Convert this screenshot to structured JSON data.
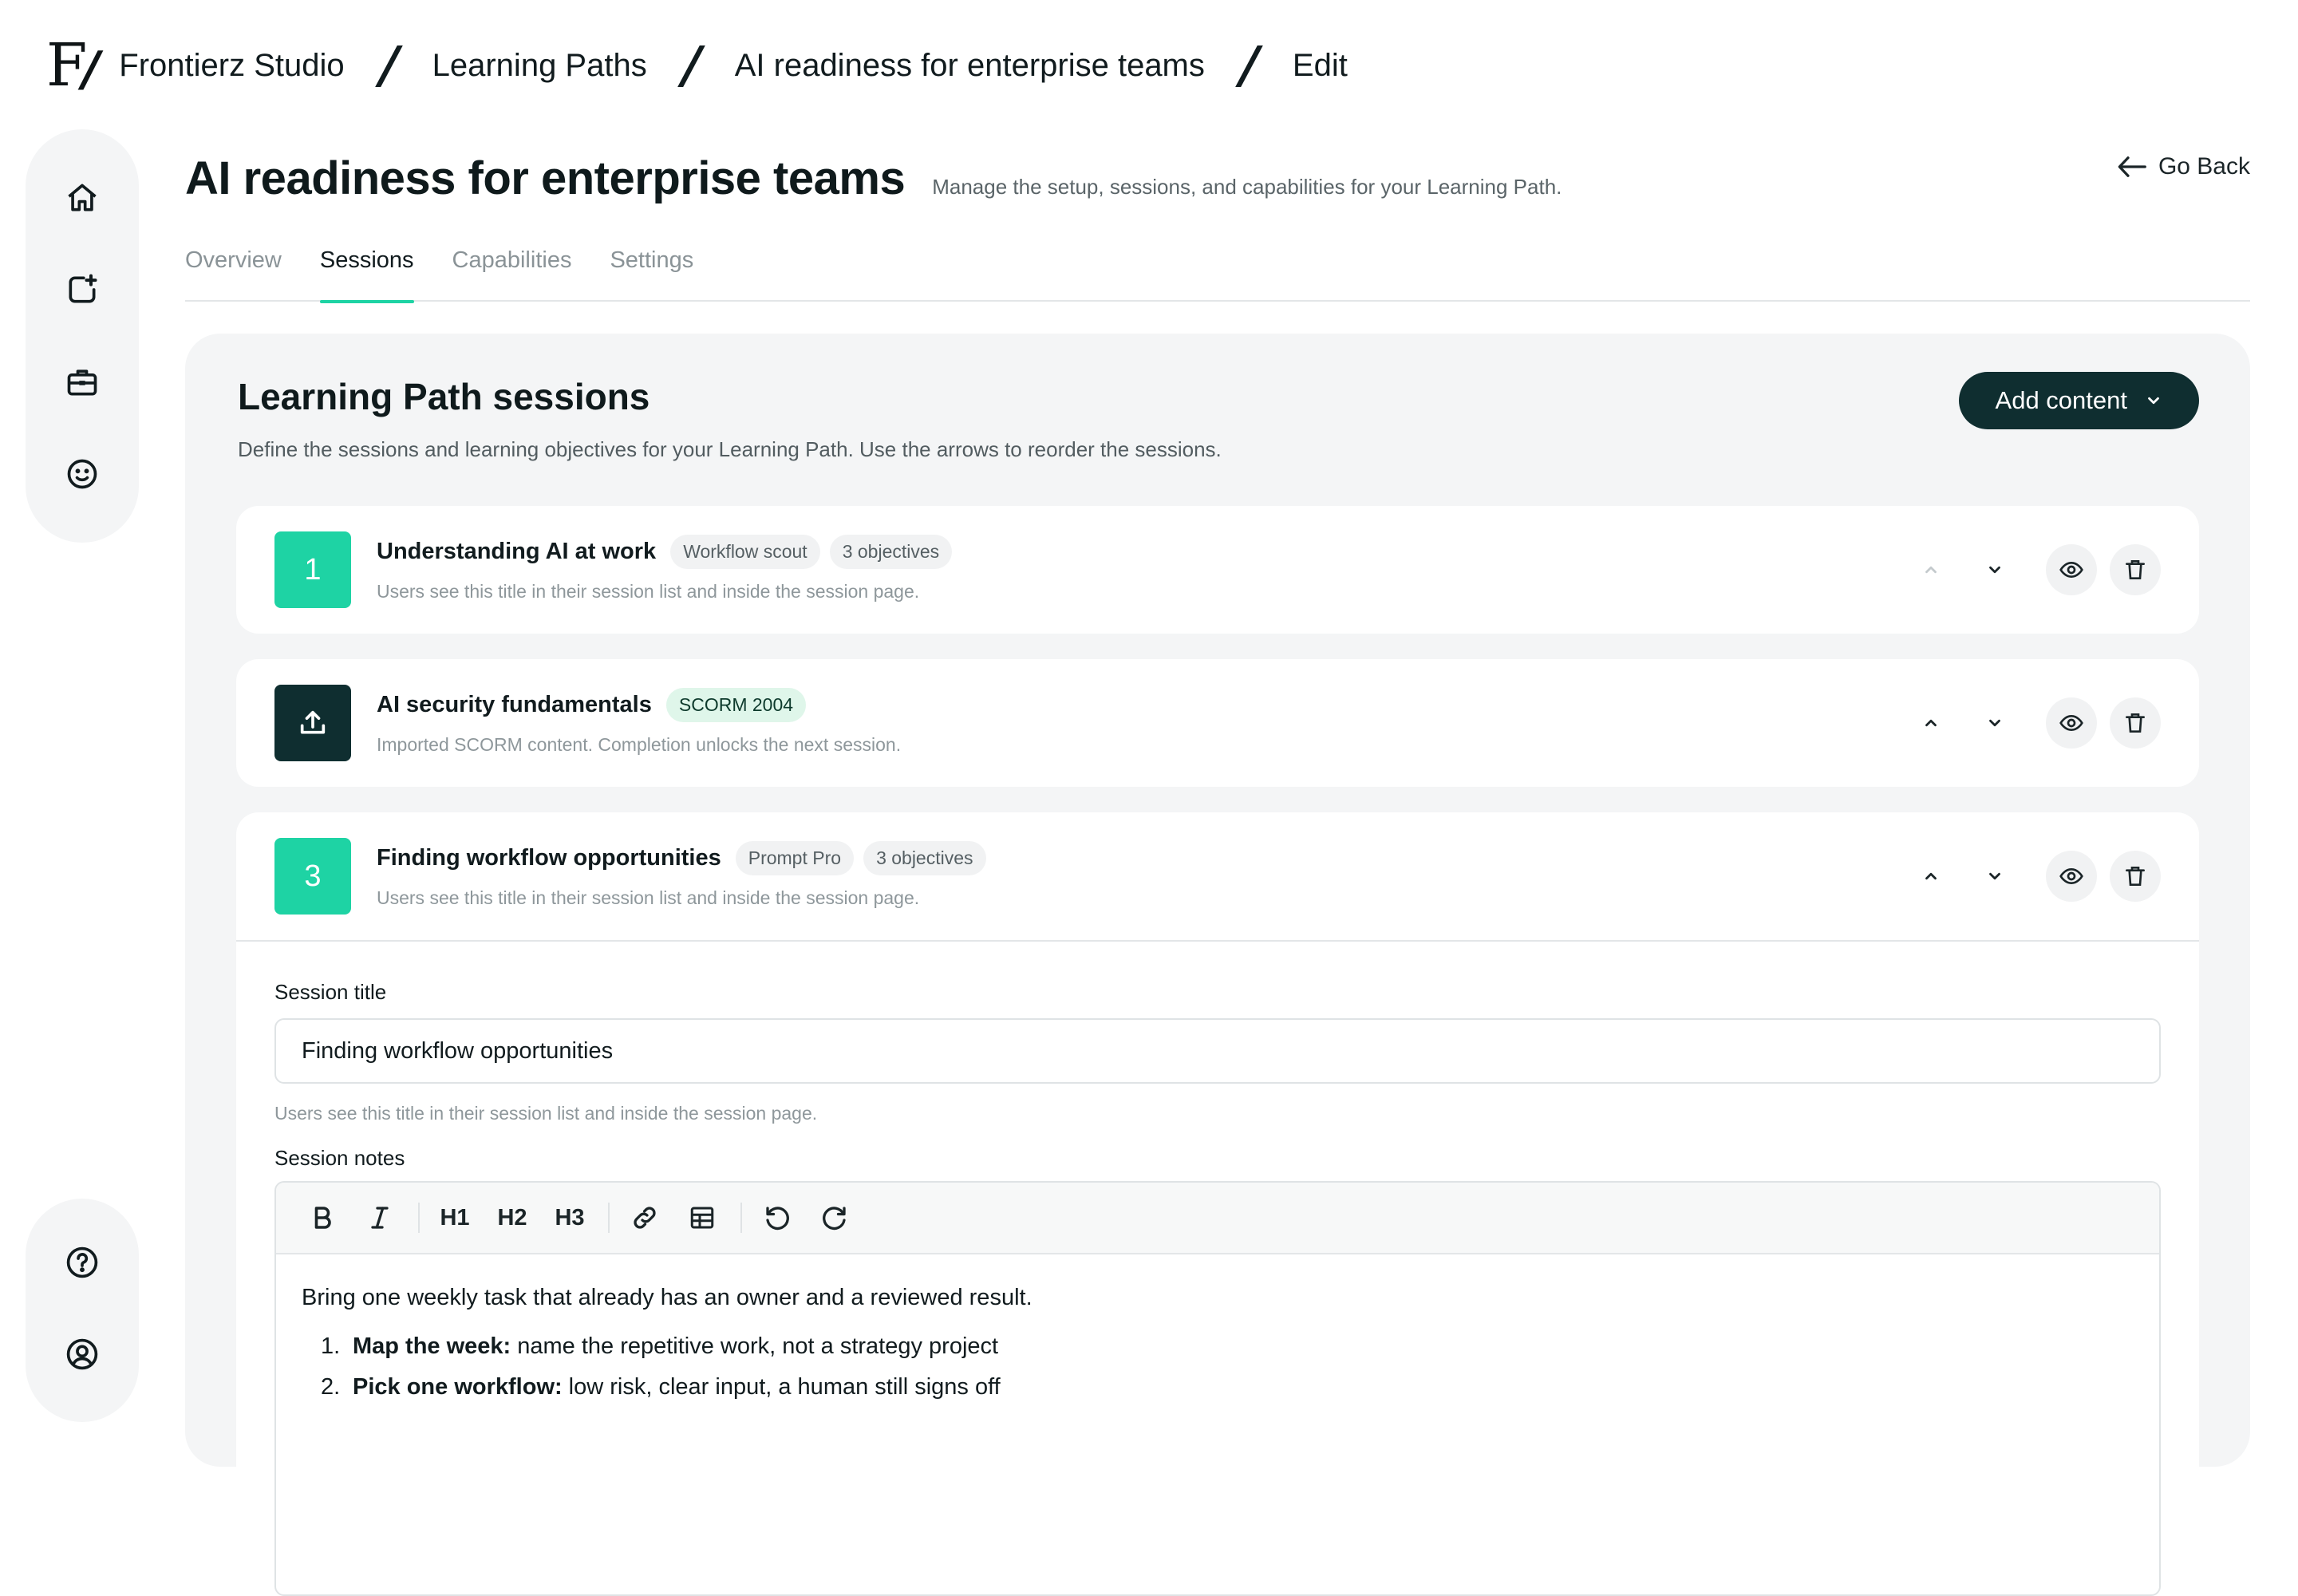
{
  "breadcrumb": {
    "logo": "F",
    "items": [
      "Frontierz Studio",
      "Learning Paths",
      "AI readiness for enterprise teams",
      "Edit"
    ]
  },
  "header": {
    "title": "AI readiness for enterprise teams",
    "subtitle": "Manage the setup, sessions, and capabilities for your Learning Path.",
    "go_back": "Go Back"
  },
  "tabs": [
    {
      "label": "Overview",
      "active": false
    },
    {
      "label": "Sessions",
      "active": true
    },
    {
      "label": "Capabilities",
      "active": false
    },
    {
      "label": "Settings",
      "active": false
    }
  ],
  "sidebar": {
    "top_icons": [
      "home-icon",
      "new-session-icon",
      "briefcase-icon",
      "smiley-icon"
    ],
    "bottom_icons": [
      "help-icon",
      "user-profile-icon"
    ]
  },
  "panel": {
    "title": "Learning Path sessions",
    "description": "Define the sessions and learning objectives for your Learning Path. Use the arrows to reorder the sessions.",
    "add_button": "Add content"
  },
  "sessions": [
    {
      "badge": "1",
      "title": "Understanding AI at work",
      "chips": [
        "Workflow scout",
        "3 objectives"
      ],
      "help": "Users see this title in their session list and inside the session page."
    },
    {
      "badge": "upload-icon",
      "title": "AI security fundamentals",
      "chips": [
        "SCORM 2004"
      ],
      "help": "Imported SCORM content. Completion unlocks the next session."
    },
    {
      "badge": "3",
      "title": "Finding workflow opportunities",
      "chips": [
        "Prompt Pro",
        "3 objectives"
      ],
      "help": "Users see this title in their session list and inside the session page."
    }
  ],
  "editor": {
    "session_title_label": "Session title",
    "session_title_value": "Finding workflow opportunities",
    "session_title_help": "Users see this title in their session list and inside the session page.",
    "notes_label": "Session notes",
    "toolbar": [
      "bold-icon",
      "italic-icon",
      "H1",
      "H2",
      "H3",
      "link-icon",
      "table-icon",
      "undo-icon",
      "redo-icon"
    ],
    "intro": "Bring one weekly task that already has an owner and a reviewed result.",
    "list": [
      {
        "num": "1.",
        "bold": "Map the week:",
        "text": "name the repetitive work, not a strategy project"
      },
      {
        "num": "2.",
        "bold": "Pick one workflow:",
        "text": "low risk, clear input, a human still signs off"
      }
    ]
  },
  "colors": {
    "accent": "#1ed3a4",
    "primary_dark": "#0f2e30",
    "panel_bg": "#f4f5f6",
    "chip_green": "#dff6ea"
  }
}
